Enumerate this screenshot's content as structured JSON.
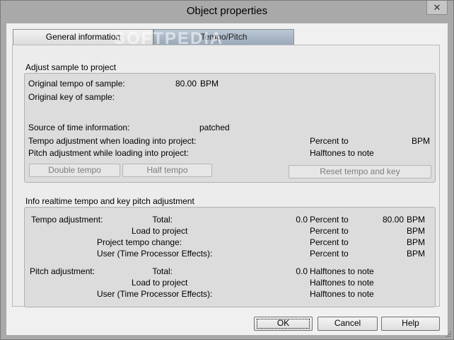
{
  "window": {
    "title": "Object properties",
    "close_glyph": "✕"
  },
  "tabs": [
    {
      "label": "General information",
      "selected": false
    },
    {
      "label": "Tempo/Pitch",
      "selected": true
    }
  ],
  "watermark": "SOFTPEDIA",
  "adjust": {
    "title": "Adjust sample to project",
    "original_tempo_label": "Original tempo of sample:",
    "original_tempo_value": "80.00",
    "original_tempo_unit": "BPM",
    "original_key_label": "Original key of sample:",
    "source_label": "Source of time information:",
    "source_value": "patched",
    "tempo_adj_label": "Tempo adjustment when loading into project:",
    "tempo_adj_percent": "Percent to",
    "tempo_adj_unit": "BPM",
    "pitch_adj_label": "Pitch adjustment while loading into project:",
    "pitch_adj_halftones": "Halftones to note",
    "double_tempo": "Double tempo",
    "half_tempo": "Half tempo",
    "reset": "Reset tempo and key"
  },
  "info": {
    "title": "Info realtime tempo and key pitch adjustment",
    "tempo_label": "Tempo adjustment:",
    "tempo_rows": [
      {
        "label": "Total:",
        "value": "0.0",
        "unit": "Percent to",
        "bpm_value": "80.00",
        "bpm": "BPM"
      },
      {
        "label": "Load to project",
        "value": "",
        "unit": "Percent to",
        "bpm_value": "",
        "bpm": "BPM"
      },
      {
        "label": "Project tempo change:",
        "value": "",
        "unit": "Percent to",
        "bpm_value": "",
        "bpm": "BPM"
      },
      {
        "label": "User (Time Processor Effects):",
        "value": "",
        "unit": "Percent to",
        "bpm_value": "",
        "bpm": "BPM"
      }
    ],
    "pitch_label": "Pitch adjustment:",
    "pitch_rows": [
      {
        "label": "Total:",
        "value": "0.0",
        "unit": "Halftones to note"
      },
      {
        "label": "Load to project",
        "value": "",
        "unit": "Halftones to note"
      },
      {
        "label": "User (Time Processor Effects):",
        "value": "",
        "unit": "Halftones to note"
      }
    ]
  },
  "buttons": {
    "ok": "OK",
    "cancel": "Cancel",
    "help": "Help"
  }
}
